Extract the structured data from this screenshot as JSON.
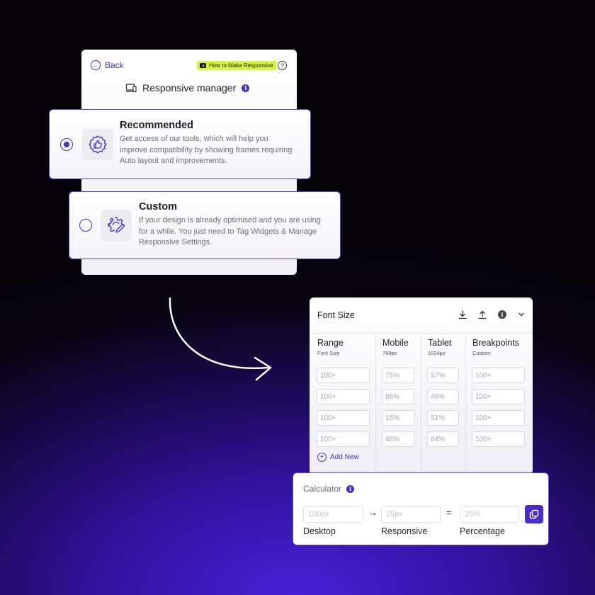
{
  "responsive_panel": {
    "back_label": "Back",
    "tutorial_label": "How to Make Responsive",
    "title": "Responsive manager",
    "options": [
      {
        "title": "Recommended",
        "description_lines": [
          "Get access of our tools, which will help you",
          "improve compatibility by showing frames requiring",
          "Auto layout and improvements."
        ],
        "selected": true
      },
      {
        "title": "Custom",
        "description_lines": [
          "If your design is already optimised and you are using",
          "for a while. You just need to Tag Widgets & Manage",
          "Responsive Settings."
        ],
        "selected": false
      }
    ]
  },
  "font_size_panel": {
    "title": "Font Size",
    "columns": [
      {
        "header": "Range",
        "sub": "Font Size",
        "values": [
          "100+",
          "100+",
          "100+",
          "100+"
        ]
      },
      {
        "header": "Mobile",
        "sub": "768px",
        "values": [
          "75%",
          "85%",
          "15%",
          "48%"
        ]
      },
      {
        "header": "Tablet",
        "sub": "1024px",
        "values": [
          "57%",
          "46%",
          "51%",
          "84%"
        ]
      },
      {
        "header": "Breakpoints",
        "sub": "Custom",
        "values": [
          "100+",
          "100+",
          "100+",
          "100+"
        ]
      }
    ],
    "add_new_label": "Add New"
  },
  "calculator": {
    "title": "Calculator",
    "desktop_placeholder": "100px",
    "responsive_placeholder": "25px",
    "percentage_placeholder": "25%",
    "desktop_label": "Desktop",
    "responsive_label": "Responsive",
    "percentage_label": "Percentage",
    "arrow_symbol": "→",
    "equals_symbol": "="
  },
  "colors": {
    "accent": "#4b2bd1",
    "tutorial_badge": "#d6f53a",
    "background_glow": "#4a1fd6"
  }
}
